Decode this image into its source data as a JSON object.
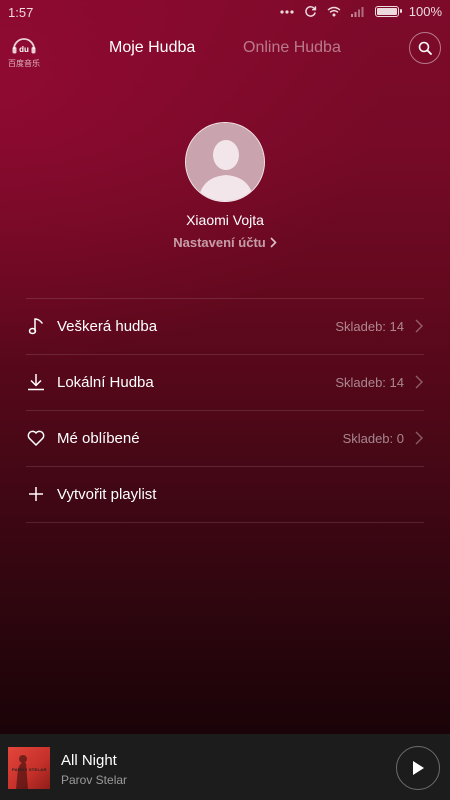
{
  "status_bar": {
    "time": "1:57",
    "battery": "100%"
  },
  "header": {
    "logo_sub": "百度音乐",
    "tabs": [
      {
        "label": "Moje Hudba",
        "active": true
      },
      {
        "label": "Online Hudba",
        "active": false
      }
    ]
  },
  "profile": {
    "name": "Xiaomi Vojta",
    "settings_label": "Nastavení účtu"
  },
  "menu": {
    "items": [
      {
        "icon": "music-note-icon",
        "label": "Veškerá hudba",
        "count": "Skladeb: 14"
      },
      {
        "icon": "download-icon",
        "label": "Lokální Hudba",
        "count": "Skladeb: 14"
      },
      {
        "icon": "heart-icon",
        "label": "Mé oblíbené",
        "count": "Skladeb: 0"
      },
      {
        "icon": "plus-icon",
        "label": "Vytvořit playlist",
        "count": ""
      }
    ]
  },
  "player": {
    "title": "All Night",
    "artist": "Parov Stelar",
    "cover_text": "PAROV STELAR"
  },
  "colors": {
    "background_top": "#7e0a2a",
    "background_bottom": "#140307",
    "player_bar": "#1c1c1c"
  }
}
